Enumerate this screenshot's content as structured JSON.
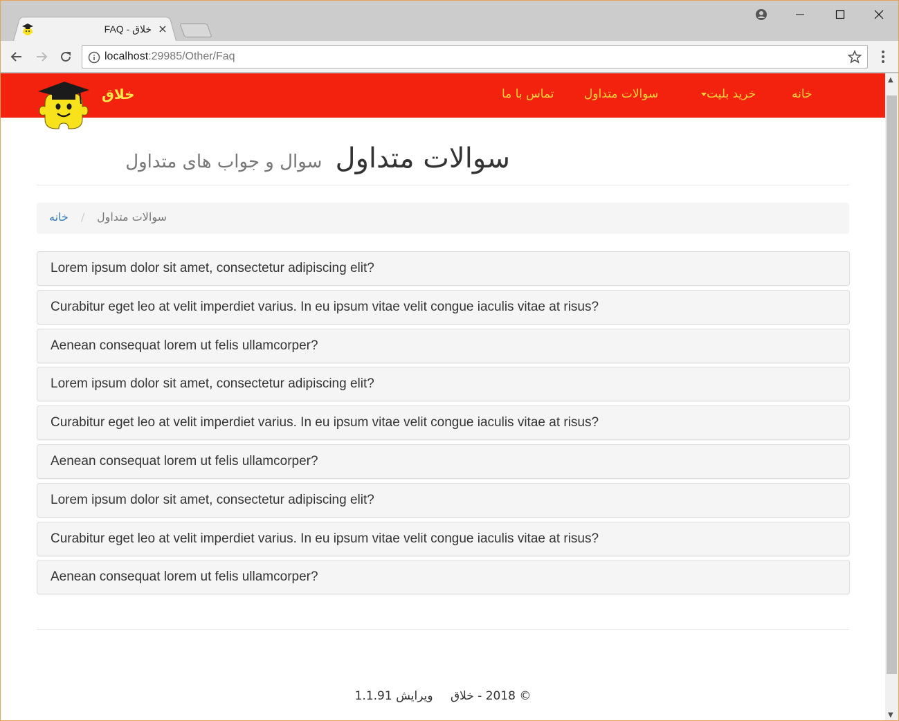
{
  "browser": {
    "tab_title": "FAQ - خلاق",
    "tab_close": "×",
    "url_host": "localhost",
    "url_path": ":29985/Other/Faq"
  },
  "navbar": {
    "brand": "خلاق",
    "links": {
      "home": "خانه",
      "buy_ticket": "خرید بلیت",
      "faq": "سوالات متداول",
      "contact": "تماس با ما"
    },
    "colors": {
      "background": "#f3220f",
      "link": "#f7d33a",
      "brand": "#f7e94a"
    }
  },
  "page": {
    "title": "سوالات متداول",
    "subtitle": "سوال و جواب های متداول"
  },
  "breadcrumb": {
    "home": "خانه",
    "separator": "/",
    "current": "سوالات متداول"
  },
  "faq": [
    "Lorem ipsum dolor sit amet, consectetur adipiscing elit?",
    "Curabitur eget leo at velit imperdiet varius. In eu ipsum vitae velit congue iaculis vitae at risus?",
    "Aenean consequat lorem ut felis ullamcorper?",
    "Lorem ipsum dolor sit amet, consectetur adipiscing elit?",
    "Curabitur eget leo at velit imperdiet varius. In eu ipsum vitae velit congue iaculis vitae at risus?",
    "Aenean consequat lorem ut felis ullamcorper?",
    "Lorem ipsum dolor sit amet, consectetur adipiscing elit?",
    "Curabitur eget leo at velit imperdiet varius. In eu ipsum vitae velit congue iaculis vitae at risus?",
    "Aenean consequat lorem ut felis ullamcorper?"
  ],
  "footer": {
    "copyright": "© 2018 - خلاق",
    "version": "ویرایش 1.1.91"
  },
  "icons": {
    "favicon": "mascot-icon",
    "account": "account-icon",
    "minimize": "minimize-icon",
    "maximize": "maximize-icon",
    "close": "close-icon",
    "back": "back-arrow-icon",
    "forward": "forward-arrow-icon",
    "reload": "reload-icon",
    "info": "info-icon",
    "bookmark": "star-icon",
    "menu": "kebab-menu-icon",
    "logo": "mascot-logo"
  }
}
